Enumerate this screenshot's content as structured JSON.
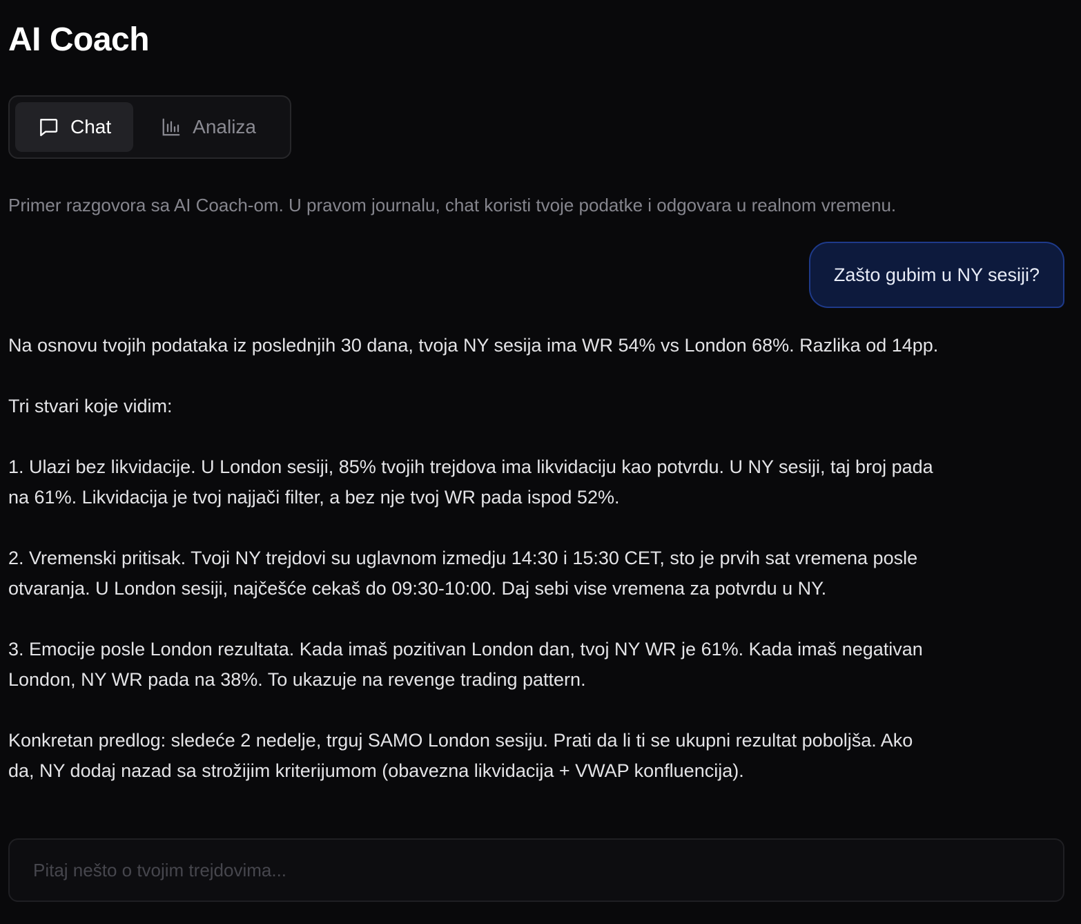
{
  "header": {
    "title": "AI Coach"
  },
  "tabs": [
    {
      "label": "Chat",
      "icon": "chat-bubble-icon",
      "active": true
    },
    {
      "label": "Analiza",
      "icon": "bar-chart-icon",
      "active": false
    }
  ],
  "intro": "Primer razgovora sa AI Coach-om. U pravom journalu, chat koristi tvoje podatke i odgovara u realnom vremenu.",
  "messages": {
    "user": "Zašto gubim u NY sesiji?",
    "assistant": [
      "Na osnovu tvojih podataka iz poslednjih 30 dana, tvoja NY sesija ima WR 54% vs London 68%. Razlika od 14pp.",
      "Tri stvari koje vidim:",
      "1. Ulazi bez likvidacije. U London sesiji, 85% tvojih trejdova ima likvidaciju kao potvrdu. U NY sesiji, taj broj pada na 61%. Likvidacija je tvoj najjači filter, a bez nje tvoj WR pada ispod 52%.",
      "2. Vremenski pritisak. Tvoji NY trejdovi su uglavnom izmedju 14:30 i 15:30 CET, sto je prvih sat vremena posle otvaranja. U London sesiji, najčešće cekaš do 09:30-10:00. Daj sebi vise vremena za potvrdu u NY.",
      "3. Emocije posle London rezultata. Kada imaš pozitivan London dan, tvoj NY WR je 61%. Kada imaš negativan London, NY WR pada na 38%. To ukazuje na revenge trading pattern.",
      "Konkretan predlog: sledeće 2 nedelje, trguj SAMO London sesiju. Prati da li ti se ukupni rezultat poboljša. Ako da, NY dodaj nazad sa strožijim kriterijumom (obavezna likvidacija + VWAP konfluencija)."
    ]
  },
  "composer": {
    "placeholder": "Pitaj nešto o tvojim trejdovima...",
    "value": ""
  },
  "colors": {
    "background": "#09090b",
    "user_bubble": "#0d1a3d",
    "user_bubble_border": "#1e3a8a",
    "muted_text": "#85858d"
  }
}
